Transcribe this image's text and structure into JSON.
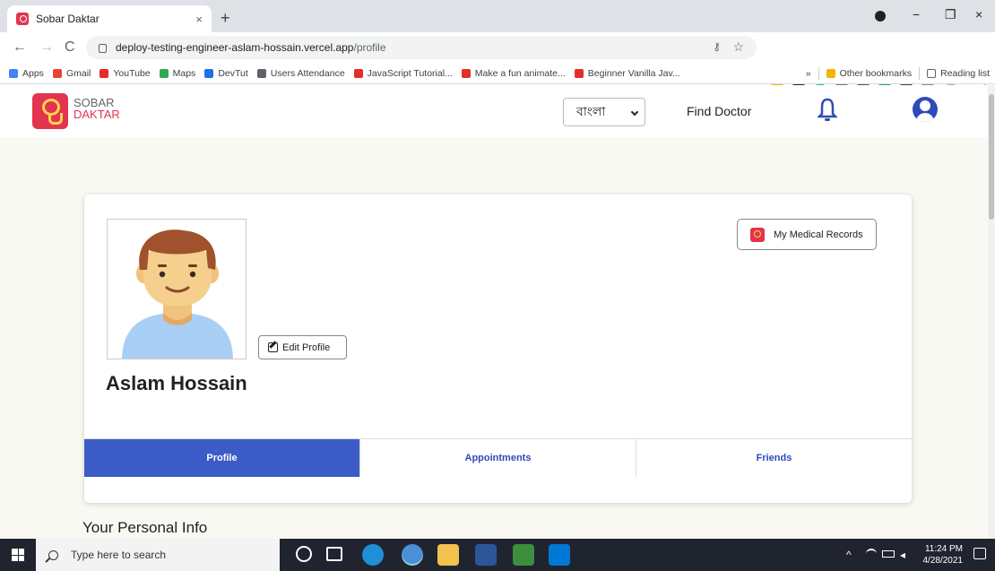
{
  "browser": {
    "tab_title": "Sobar Daktar",
    "tab_close": "×",
    "new_tab": "+",
    "url_host": "deploy-testing-engineer-aslam-hossain.vercel.app",
    "url_path": "/profile",
    "window_min": "−",
    "window_restore": "❐",
    "window_close": "×"
  },
  "bookmarks": {
    "items": [
      {
        "label": "Apps",
        "color": "#4285f4"
      },
      {
        "label": "Gmail",
        "color": "#ea4335"
      },
      {
        "label": "YouTube",
        "color": "#e52d27"
      },
      {
        "label": "Maps",
        "color": "#34a853"
      },
      {
        "label": "DevTut",
        "color": "#1a73e8"
      },
      {
        "label": "Users Attendance",
        "color": "#5f6368"
      },
      {
        "label": "JavaScript Tutorial...",
        "color": "#e52d27"
      },
      {
        "label": "Make a fun animate...",
        "color": "#e52d27"
      },
      {
        "label": "Beginner Vanilla Jav...",
        "color": "#e52d27"
      }
    ],
    "overflow": "»",
    "other": "Other bookmarks",
    "reading_list": "Reading list"
  },
  "site": {
    "logo_line1": "SOBAR",
    "logo_line2": "DAKTAR",
    "language": "বাংলা",
    "find_doctor": "Find Doctor",
    "edit_profile": "Edit Profile",
    "user_name": "Aslam Hossain",
    "medical_records": "My Medical Records",
    "tabs": [
      "Profile",
      "Appointments",
      "Friends"
    ],
    "active_tab": "Profile",
    "section_title": "Your Personal Info"
  },
  "taskbar": {
    "search_placeholder": "Type here to search",
    "time": "11:24 PM",
    "date": "4/28/2021"
  },
  "colors": {
    "brand": "#e3344f",
    "accent": "#3b5bc6"
  }
}
